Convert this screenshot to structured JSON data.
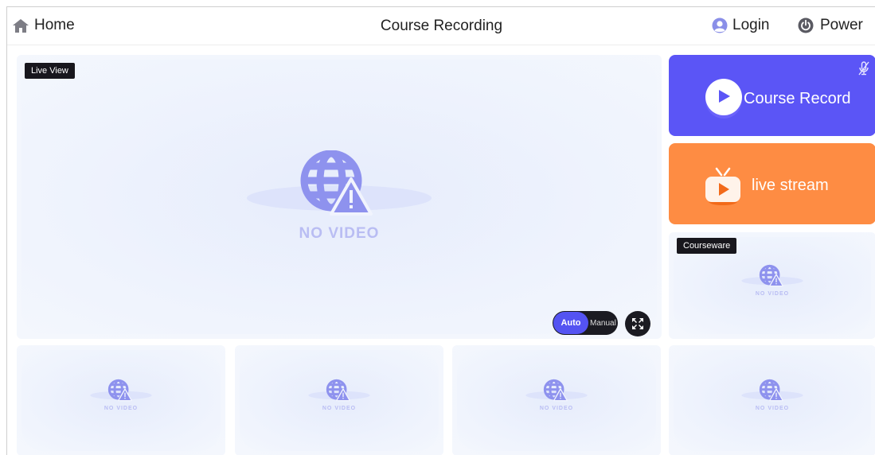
{
  "header": {
    "home_label": "Home",
    "title": "Course Recording",
    "login_label": "Login",
    "power_label": "Power",
    "icons": {
      "home": "home-icon",
      "login": "user-icon",
      "power": "power-icon"
    }
  },
  "main_view": {
    "label": "Live View",
    "no_video_text": "NO VIDEO",
    "mode_toggle": {
      "auto_label": "Auto",
      "manual_label": "Manual",
      "selected": "Auto"
    },
    "fullscreen_icon": "fullscreen-icon"
  },
  "actions": {
    "course_record": {
      "label": "Course Record",
      "icon": "play-icon",
      "mic_icon": "mic-muted-icon",
      "color": "#5b55f6"
    },
    "live_stream": {
      "label": "live stream",
      "icon": "tv-icon",
      "color": "#fe8c43"
    }
  },
  "courseware": {
    "label": "Courseware",
    "no_video_text": "NO VIDEO"
  },
  "thumbnails": [
    {
      "no_video_text": "NO VIDEO"
    },
    {
      "no_video_text": "NO VIDEO"
    },
    {
      "no_video_text": "NO VIDEO"
    },
    {
      "no_video_text": "NO VIDEO"
    }
  ],
  "colors": {
    "accent": "#5453f2",
    "no_video_icon": "#8e92ee",
    "no_video_text": "#b9bdf3"
  }
}
